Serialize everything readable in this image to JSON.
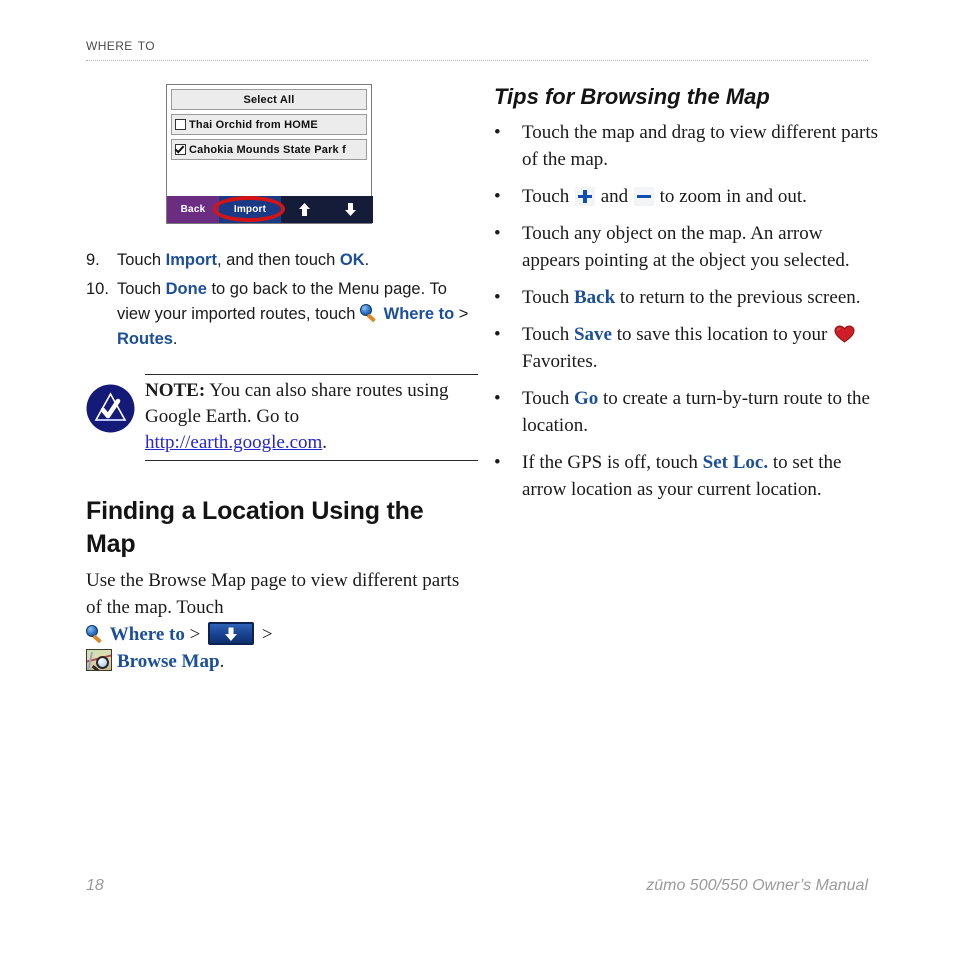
{
  "header": {
    "running_head": "Where To"
  },
  "device_screenshot": {
    "name": "route-import-screen",
    "rows": [
      {
        "label": "Select All",
        "checkbox": "none",
        "align": "center"
      },
      {
        "label": "Thai Orchid from HOME",
        "checkbox": "unchecked",
        "align": "left"
      },
      {
        "label": "Cahokia Mounds State Park f",
        "checkbox": "checked",
        "align": "left"
      }
    ],
    "buttons": {
      "back": "Back",
      "import": "Import",
      "scroll_up": "⬆",
      "scroll_down": "⬇"
    },
    "highlight": "red-oval-around-import"
  },
  "steps": [
    {
      "number": "9.",
      "parts": [
        {
          "t": "Touch ",
          "style": "normal"
        },
        {
          "t": "Import",
          "style": "ui"
        },
        {
          "t": ", and then touch ",
          "style": "normal"
        },
        {
          "t": "OK",
          "style": "ui"
        },
        {
          "t": ".",
          "style": "normal"
        }
      ]
    },
    {
      "number": "10.",
      "parts": [
        {
          "t": "Touch ",
          "style": "normal"
        },
        {
          "t": "Done",
          "style": "ui"
        },
        {
          "t": " to go back to the Menu page. To view your imported routes, touch ",
          "style": "normal"
        },
        {
          "t": "magnifier-icon",
          "style": "icon"
        },
        {
          "t": "Where to",
          "style": "ui"
        },
        {
          "t": " > ",
          "style": "normal"
        },
        {
          "t": "Routes",
          "style": "ui"
        },
        {
          "t": ".",
          "style": "normal"
        }
      ]
    }
  ],
  "note": {
    "icon": "note-triangle-check-icon",
    "label": "NOTE:",
    "text": " You can also share routes using Google Earth. Go to ",
    "url": "http://earth.google.com",
    "period": "."
  },
  "section": {
    "heading": "Finding a Location Using the Map",
    "paragraph_lead": "Use the Browse Map page to view different parts of the map. Touch ",
    "where_to": "Where to",
    "gt1": " > ",
    "gt2": " > ",
    "browse_map": "Browse Map",
    "period": "."
  },
  "tips": {
    "heading": "Tips for Browsing the Map",
    "bullet_char": "•",
    "items": [
      {
        "parts": [
          {
            "t": "Touch the map and drag to view different parts of the map.",
            "style": "normal"
          }
        ]
      },
      {
        "parts": [
          {
            "t": "Touch ",
            "style": "normal"
          },
          {
            "t": "plus-icon",
            "style": "icon"
          },
          {
            "t": " and ",
            "style": "normal"
          },
          {
            "t": "minus-icon",
            "style": "icon"
          },
          {
            "t": " to zoom in and out.",
            "style": "normal"
          }
        ]
      },
      {
        "parts": [
          {
            "t": "Touch any object on the map. An arrow appears pointing at the object you selected.",
            "style": "normal"
          }
        ]
      },
      {
        "parts": [
          {
            "t": "Touch ",
            "style": "normal"
          },
          {
            "t": "Back",
            "style": "ui"
          },
          {
            "t": " to return to the previous screen.",
            "style": "normal"
          }
        ]
      },
      {
        "parts": [
          {
            "t": "Touch ",
            "style": "normal"
          },
          {
            "t": "Save",
            "style": "ui"
          },
          {
            "t": " to save this location to your ",
            "style": "normal"
          },
          {
            "t": "heart-icon",
            "style": "icon"
          },
          {
            "t": " Favorites.",
            "style": "normal"
          }
        ]
      },
      {
        "parts": [
          {
            "t": "Touch ",
            "style": "normal"
          },
          {
            "t": "Go",
            "style": "ui"
          },
          {
            "t": " to create a turn-by-turn route to the location.",
            "style": "normal"
          }
        ]
      },
      {
        "parts": [
          {
            "t": "If the GPS is off, touch ",
            "style": "normal"
          },
          {
            "t": "Set Loc.",
            "style": "ui"
          },
          {
            "t": " to set the arrow location as your current location.",
            "style": "normal"
          }
        ]
      }
    ]
  },
  "footer": {
    "page_number": "18",
    "manual_title": "zūmo 500/550 Owner’s Manual"
  },
  "colors": {
    "ui_blue": "#1b4f9c",
    "link_blue": "#2626cc",
    "note_navy": "#141a78",
    "device_back": "#6b2d82",
    "device_import": "#1a3a86",
    "highlight_red": "#d41414",
    "footer_gray": "#9a9a9a"
  }
}
